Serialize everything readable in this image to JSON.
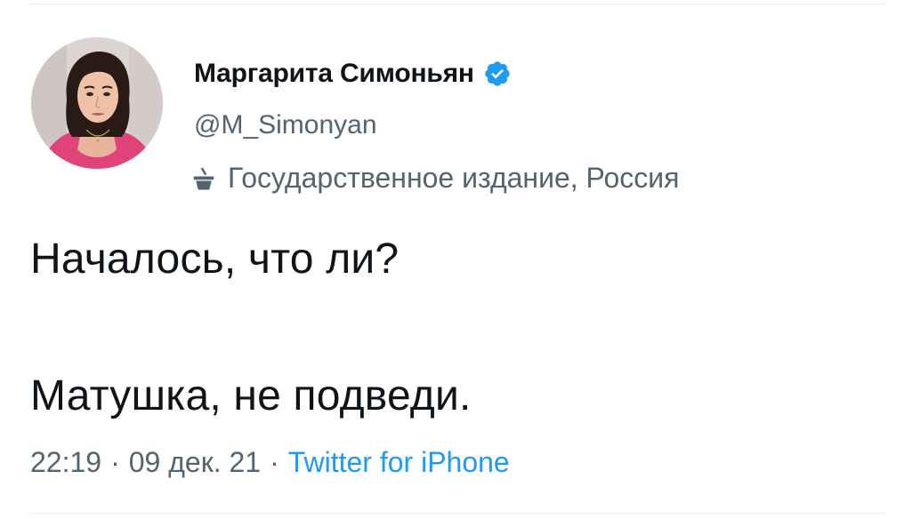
{
  "author": {
    "display_name": "Маргарита Симоньян",
    "handle": "@M_Simonyan",
    "verified_icon": "verified-badge-icon",
    "label": "Государственное издание, Россия",
    "label_icon": "state-media-podium-icon"
  },
  "tweet": {
    "line_1": "Началось, что ли?",
    "line_2": "Матушка, не подведи."
  },
  "meta": {
    "time": "22:19",
    "separator": "·",
    "date": "09 дек. 21",
    "source": "Twitter for iPhone"
  },
  "colors": {
    "text": "#0f1419",
    "secondary": "#536471",
    "link": "#1d9bf0",
    "verified": "#1d9bf0"
  }
}
